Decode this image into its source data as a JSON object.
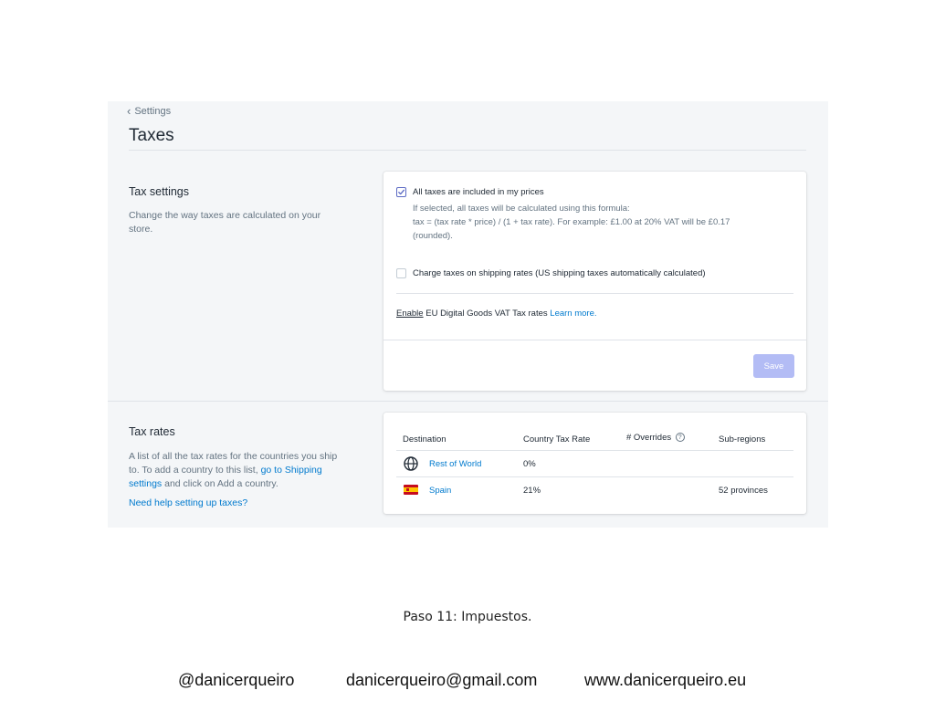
{
  "header": {
    "back_label": "Settings",
    "title": "Taxes"
  },
  "tax_settings": {
    "title": "Tax settings",
    "description_line1": "Change the way taxes are calculated on your",
    "description_line2": "store.",
    "option_included": {
      "checked": true,
      "label": "All taxes are included in my prices",
      "help_line1": "If selected, all taxes will be calculated using this formula:",
      "help_line2": "tax = (tax rate * price) / (1 + tax rate). For example: £1.00 at 20% VAT will be £0.17",
      "help_line3": "(rounded)."
    },
    "option_shipping": {
      "checked": false,
      "label": "Charge taxes on shipping rates (US shipping taxes automatically calculated)"
    },
    "eu": {
      "enable": "Enable",
      "text": " EU Digital Goods VAT Tax rates ",
      "learn_more": "Learn more."
    },
    "save_label": "Save",
    "save_color": "#b3bcf5"
  },
  "tax_rates": {
    "title": "Tax rates",
    "desc_line1": "A list of all the tax rates for the countries you ship",
    "desc_line2_a": "to. To add a country to this list, ",
    "desc_line2_link": "go to Shipping",
    "desc_line3_link": "settings",
    "desc_line3_b": " and click on Add a country.",
    "help_link": "Need help setting up taxes?",
    "columns": {
      "destination": "Destination",
      "country_rate": "Country Tax Rate",
      "overrides": "# Overrides",
      "overrides_icon": "?",
      "subregions": "Sub-regions"
    },
    "rows": [
      {
        "icon": "globe-icon",
        "destination": "Rest of World",
        "rate": "0%",
        "overrides": "",
        "subregions": ""
      },
      {
        "icon": "spain-flag-icon",
        "destination": "Spain",
        "rate": "21%",
        "overrides": "",
        "subregions": "52 provinces"
      }
    ]
  },
  "caption": {
    "bold": "Paso 11:",
    "text": " Impuestos."
  },
  "footer": {
    "handle": "@danicerqueiro",
    "email": "danicerqueiro@gmail.com",
    "website": "www.danicerqueiro.eu"
  },
  "colors": {
    "accent": "#5c6ac4",
    "link": "#007ace",
    "background": "#f4f6f8"
  }
}
